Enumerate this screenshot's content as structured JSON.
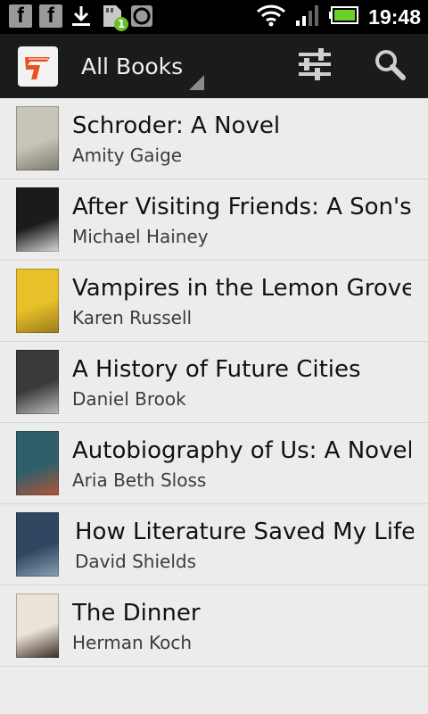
{
  "status_bar": {
    "time": "19:48",
    "notification_count": "1",
    "icons": [
      "facebook-icon",
      "facebook-icon",
      "download-icon",
      "sd-card-icon",
      "circle-icon"
    ],
    "right_icons": [
      "wifi-icon",
      "signal-icon",
      "battery-icon"
    ]
  },
  "action_bar": {
    "title": "All Books",
    "logo_icon": "app-logo-icon",
    "filter_icon": "sliders-icon",
    "search_icon": "search-icon",
    "logo_accent": "#e8521f"
  },
  "books": [
    {
      "title": "Schroder: A Novel",
      "author": "Amity Gaige",
      "cover_colors": [
        "#c8c4b8",
        "#7d7a70"
      ]
    },
    {
      "title": "After Visiting Friends: A Son's Story",
      "author": "Michael Hainey",
      "cover_colors": [
        "#1b1b1b",
        "#d9d9d9"
      ]
    },
    {
      "title": "Vampires in the Lemon Grove: Stories",
      "author": "Karen Russell",
      "cover_colors": [
        "#e8c12a",
        "#9b7b1c"
      ]
    },
    {
      "title": "A History of Future Cities",
      "author": "Daniel Brook",
      "cover_colors": [
        "#3a3a3a",
        "#bcbcbc"
      ]
    },
    {
      "title": "Autobiography of Us: A Novel",
      "author": "Aria Beth Sloss",
      "cover_colors": [
        "#2f5f69",
        "#b2563a"
      ]
    },
    {
      "title": "How Literature Saved My Life",
      "author": "David Shields",
      "cover_colors": [
        "#2e4660",
        "#8aa0b4"
      ]
    },
    {
      "title": "The Dinner",
      "author": "Herman Koch",
      "cover_colors": [
        "#e9e3d8",
        "#3b2a22"
      ]
    }
  ]
}
